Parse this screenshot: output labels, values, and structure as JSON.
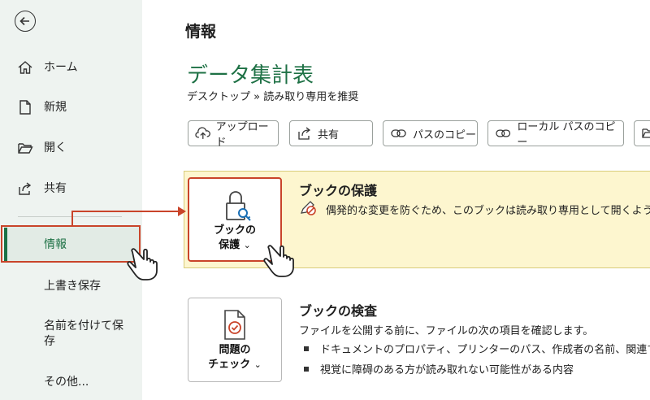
{
  "sidebar": {
    "items": [
      {
        "label": "ホーム",
        "icon": "home-icon"
      },
      {
        "label": "新規",
        "icon": "new-document-icon"
      },
      {
        "label": "開く",
        "icon": "open-folder-icon"
      },
      {
        "label": "共有",
        "icon": "share-icon"
      },
      {
        "label": "情報",
        "active": true
      },
      {
        "label": "上書き保存"
      },
      {
        "label": "名前を付けて保存"
      },
      {
        "label": "その他..."
      }
    ]
  },
  "main": {
    "title": "情報",
    "doc_title": "データ集計表",
    "breadcrumb": {
      "location": "デスクトップ",
      "sep": "»",
      "status": "読み取り専用を推奨"
    },
    "actions": [
      {
        "label": "アップロード",
        "icon": "upload-icon"
      },
      {
        "label": "共有",
        "icon": "share-icon"
      },
      {
        "label": "パスのコピー",
        "icon": "link-icon"
      },
      {
        "label": "ローカル パスのコピー",
        "icon": "link-icon"
      }
    ],
    "protect": {
      "button_line1": "ブックの",
      "button_line2": "保護",
      "chevron": "⌄",
      "title": "ブックの保護",
      "desc": "偶発的な変更を防ぐため、このブックは読み取り専用として開くよう設定"
    },
    "inspect": {
      "button_line1": "問題の",
      "button_line2": "チェック",
      "chevron": "⌄",
      "title": "ブックの検査",
      "desc": "ファイルを公開する前に、ファイルの次の項目を確認します。",
      "bullets": [
        "ドキュメントのプロパティ、プリンターのパス、作成者の名前、関連する日",
        "視覚に障碍のある方が読み取れない可能性がある内容"
      ]
    }
  },
  "colors": {
    "accent": "#1e7145",
    "callout": "#c9442a",
    "panel": "#fdf6cf"
  }
}
